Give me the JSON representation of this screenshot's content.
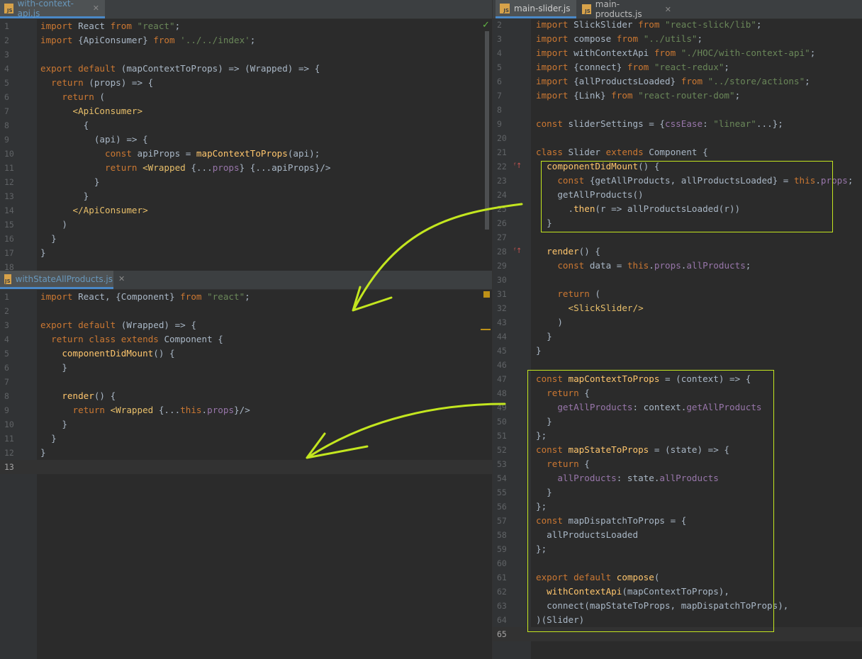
{
  "panes": {
    "left_top": {
      "tab": "with-context-api.js",
      "lines": [
        {
          "n": "1",
          "t": "import React from \"react\";"
        },
        {
          "n": "2",
          "t": "import {ApiConsumer} from '../../index';"
        },
        {
          "n": "3",
          "t": ""
        },
        {
          "n": "4",
          "t": "export default (mapContextToProps) => (Wrapped) => {"
        },
        {
          "n": "5",
          "t": "  return (props) => {"
        },
        {
          "n": "6",
          "t": "    return ("
        },
        {
          "n": "7",
          "t": "      <ApiConsumer>"
        },
        {
          "n": "8",
          "t": "        {"
        },
        {
          "n": "9",
          "t": "          (api) => {"
        },
        {
          "n": "10",
          "t": "            const apiProps = mapContextToProps(api);"
        },
        {
          "n": "11",
          "t": "            return <Wrapped {...props} {...apiProps}/>"
        },
        {
          "n": "12",
          "t": "          }"
        },
        {
          "n": "13",
          "t": "        }"
        },
        {
          "n": "14",
          "t": "      </ApiConsumer>"
        },
        {
          "n": "15",
          "t": "    )"
        },
        {
          "n": "16",
          "t": "  }"
        },
        {
          "n": "17",
          "t": "}"
        },
        {
          "n": "18",
          "t": ""
        }
      ]
    },
    "left_bottom": {
      "tab": "withStateAllProducts.js",
      "lines": [
        {
          "n": "1",
          "t": "import React, {Component} from \"react\";"
        },
        {
          "n": "2",
          "t": ""
        },
        {
          "n": "3",
          "t": "export default (Wrapped) => {"
        },
        {
          "n": "4",
          "t": "  return class extends Component {"
        },
        {
          "n": "5",
          "t": "    componentDidMount() {"
        },
        {
          "n": "6",
          "t": "    }"
        },
        {
          "n": "7",
          "t": ""
        },
        {
          "n": "8",
          "t": "    render() {"
        },
        {
          "n": "9",
          "t": "      return <Wrapped {...this.props}/>"
        },
        {
          "n": "10",
          "t": "    }"
        },
        {
          "n": "11",
          "t": "  }"
        },
        {
          "n": "12",
          "t": "}"
        },
        {
          "n": "13",
          "t": ""
        }
      ]
    },
    "right": {
      "tabs": [
        "main-slider.js",
        "main-products.js"
      ],
      "lines": [
        {
          "n": "2",
          "t": "import SlickSlider from \"react-slick/lib\";"
        },
        {
          "n": "3",
          "t": "import compose from \"../utils\";"
        },
        {
          "n": "4",
          "t": "import withContextApi from \"./HOC/with-context-api\";"
        },
        {
          "n": "5",
          "t": "import {connect} from \"react-redux\";"
        },
        {
          "n": "6",
          "t": "import {allProductsLoaded} from \"../store/actions\";"
        },
        {
          "n": "7",
          "t": "import {Link} from \"react-router-dom\";"
        },
        {
          "n": "8",
          "t": ""
        },
        {
          "n": "9",
          "t": "const sliderSettings = {cssEase: \"linear\"...};"
        },
        {
          "n": "20",
          "t": ""
        },
        {
          "n": "21",
          "t": "class Slider extends Component {"
        },
        {
          "n": "22",
          "t": "  componentDidMount() {"
        },
        {
          "n": "23",
          "t": "    const {getAllProducts, allProductsLoaded} = this.props;"
        },
        {
          "n": "24",
          "t": "    getAllProducts()"
        },
        {
          "n": "25",
          "t": "      .then(r => allProductsLoaded(r))"
        },
        {
          "n": "26",
          "t": "  }"
        },
        {
          "n": "27",
          "t": ""
        },
        {
          "n": "28",
          "t": "  render() {"
        },
        {
          "n": "29",
          "t": "    const data = this.props.allProducts;"
        },
        {
          "n": "30",
          "t": ""
        },
        {
          "n": "31",
          "t": "    return ("
        },
        {
          "n": "32",
          "t": "      <SlickSlider/>"
        },
        {
          "n": "43",
          "t": "    )"
        },
        {
          "n": "44",
          "t": "  }"
        },
        {
          "n": "45",
          "t": "}"
        },
        {
          "n": "46",
          "t": ""
        },
        {
          "n": "47",
          "t": "const mapContextToProps = (context) => {"
        },
        {
          "n": "48",
          "t": "  return {"
        },
        {
          "n": "49",
          "t": "    getAllProducts: context.getAllProducts"
        },
        {
          "n": "50",
          "t": "  }"
        },
        {
          "n": "51",
          "t": "};"
        },
        {
          "n": "52",
          "t": "const mapStateToProps = (state) => {"
        },
        {
          "n": "53",
          "t": "  return {"
        },
        {
          "n": "54",
          "t": "    allProducts: state.allProducts"
        },
        {
          "n": "55",
          "t": "  }"
        },
        {
          "n": "56",
          "t": "};"
        },
        {
          "n": "57",
          "t": "const mapDispatchToProps = {"
        },
        {
          "n": "58",
          "t": "  allProductsLoaded"
        },
        {
          "n": "59",
          "t": "};"
        },
        {
          "n": "60",
          "t": ""
        },
        {
          "n": "61",
          "t": "export default compose("
        },
        {
          "n": "62",
          "t": "  withContextApi(mapContextToProps),"
        },
        {
          "n": "63",
          "t": "  connect(mapStateToProps, mapDispatchToProps),"
        },
        {
          "n": "64",
          "t": ")(Slider)"
        },
        {
          "n": "65",
          "t": ""
        }
      ]
    }
  },
  "icon_label": "JS",
  "colors": {
    "keyword": "#cc7832",
    "string": "#6a8759",
    "function": "#ffc66d",
    "property": "#9876aa",
    "tag": "#e8bf6a",
    "annotation": "#c3e61f"
  }
}
